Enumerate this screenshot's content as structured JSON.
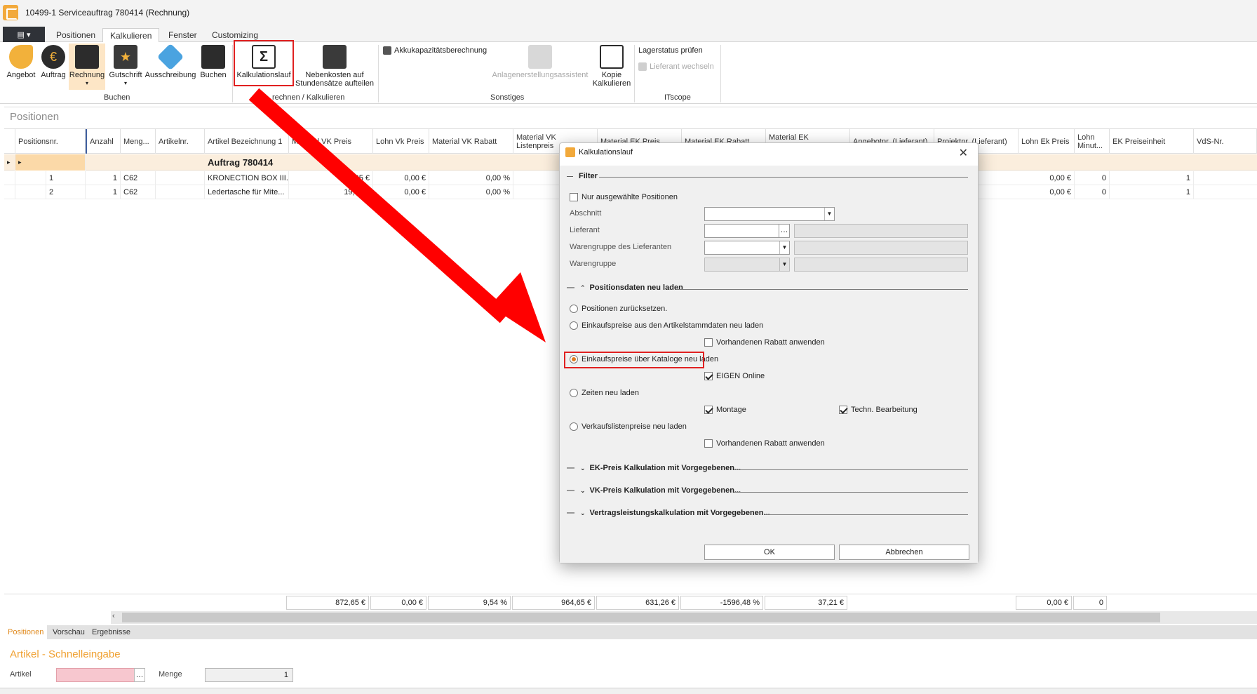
{
  "window": {
    "title": "10499-1 Serviceauftrag 780414 (Rechnung)"
  },
  "tabs": [
    {
      "label": "Positionen"
    },
    {
      "label": "Kalkulieren"
    },
    {
      "label": "Fenster"
    },
    {
      "label": "Customizing"
    }
  ],
  "ribbon": {
    "buttons": {
      "angebot": "Angebot",
      "auftrag": "Auftrag",
      "rechnung": "Rechnung",
      "gutschrift": "Gutschrift",
      "ausschreibung": "Ausschreibung",
      "buchen": "Buchen",
      "kalkulationslauf": "Kalkulationslauf",
      "nebenkosten_1": "Nebenkosten auf",
      "nebenkosten_2": "Stundensätze aufteilen",
      "akku": "Akkukapazitätsberechnung",
      "anlagen": "Anlagenerstellungsassistent",
      "kopie_1": "Kopie",
      "kopie_2": "Kalkulieren",
      "lagerstatus": "Lagerstatus prüfen",
      "lieferant_wechseln": "Lieferant wechseln"
    },
    "groups": {
      "buchen": "Buchen",
      "berechnen": "rechnen / Kalkulieren",
      "sonstiges": "Sonstiges",
      "itscope": "ITscope"
    }
  },
  "panel": {
    "title": "Positionen"
  },
  "grid": {
    "columns": [
      "Positionsnr.",
      "Anzahl",
      "Meng...",
      "Artikelnr.",
      "Artikel Bezeichnung 1",
      "Material VK Preis",
      "Lohn Vk Preis",
      "Material VK Rabatt",
      "Material VK Listenpreis",
      "Material EK Preis",
      "Material EK Rabatt",
      "Material EK Listenpreis",
      "Angebotnr. (Lieferant)",
      "Projektnr. (Lieferant)",
      "Lohn Ek Preis",
      "Lohn Minut...",
      "EK Preiseinheit",
      "VdS-Nr."
    ],
    "group_label": "Auftrag 780414",
    "rows": [
      {
        "pos": "1",
        "anzahl": "1",
        "menge": "C62",
        "artikelnr": "",
        "bez": "KRONECTION BOX III...",
        "mvk": "23,95 €",
        "lvk": "0,00 €",
        "mvkr": "0,00 %",
        "lek": "0,00 €",
        "lmin": "0",
        "ekpe": "1"
      },
      {
        "pos": "2",
        "anzahl": "1",
        "menge": "C62",
        "artikelnr": "",
        "bez": "Ledertasche für Mite...",
        "mvk": "19,50 €",
        "lvk": "0,00 €",
        "mvkr": "0,00 %",
        "lek": "0,00 €",
        "lmin": "0",
        "ekpe": "1"
      }
    ],
    "totals": {
      "mvk": "872,65 €",
      "lvk": "0,00 €",
      "mvkr": "9,54 %",
      "mvkl": "964,65 €",
      "mek": "631,26 €",
      "mekr": "-1596,48 %",
      "mekl": "37,21 €",
      "lek": "0,00 €",
      "lmin": "0"
    }
  },
  "bottom_tabs": [
    {
      "label": "Positionen"
    },
    {
      "label": "Vorschau"
    },
    {
      "label": "Ergebnisse"
    }
  ],
  "schnelleingabe": {
    "title": "Artikel - Schnelleingabe",
    "artikel_label": "Artikel",
    "menge_label": "Menge",
    "menge_value": "1"
  },
  "dialog": {
    "title": "Kalkulationslauf",
    "filter_title": "Filter",
    "nur_ausgewaehlte": "Nur ausgewählte Positionen",
    "abschnitt": "Abschnitt",
    "lieferant": "Lieferant",
    "warengruppe_lieferant": "Warengruppe des Lieferanten",
    "warengruppe": "Warengruppe",
    "positionsdaten_title": "Positionsdaten neu laden",
    "opt_reset": "Positionen zurücksetzen.",
    "opt_stamm": "Einkaufspreise aus den Artikelstammdaten neu laden",
    "opt_stamm_rabatt": "Vorhandenen Rabatt anwenden",
    "opt_katalog": "Einkaufspreise über Kataloge neu laden",
    "opt_katalog_eigen": "EIGEN Online",
    "opt_zeiten": "Zeiten neu laden",
    "opt_montage": "Montage",
    "opt_techn": "Techn. Bearbeitung",
    "opt_vk": "Verkaufslistenpreise neu laden",
    "opt_vk_rabatt": "Vorhandenen Rabatt anwenden",
    "sec_ek": "EK-Preis Kalkulation mit Vorgegebenen...",
    "sec_vk": "VK-Preis Kalkulation mit Vorgegebenen...",
    "sec_vertrag": "Vertragsleistungskalkulation mit Vorgegebenen...",
    "ok": "OK",
    "cancel": "Abbrechen"
  },
  "colors": {
    "accent": "#e08a1e",
    "highlight_box": "#e02020",
    "arrow": "#ff0000"
  },
  "icons": [
    "app-icon",
    "close-icon",
    "sigma-icon",
    "chevron-down-icon",
    "chevron-up-icon"
  ]
}
